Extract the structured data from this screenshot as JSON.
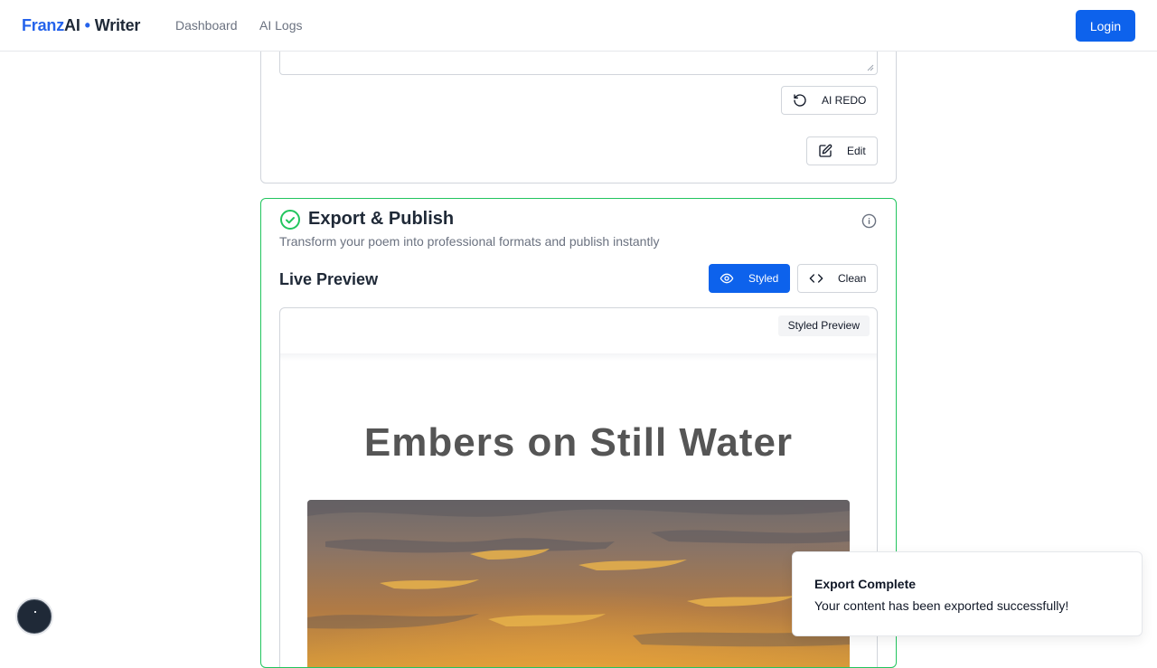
{
  "header": {
    "brand_franz": "Franz",
    "brand_ai": "AI",
    "brand_dot": "•",
    "brand_writer": "Writer",
    "nav": [
      "Dashboard",
      "AI Logs"
    ],
    "login_label": "Login"
  },
  "edit_card": {
    "redo_label": "AI REDO",
    "redo_icon": "rotate-ccw-icon",
    "edit_label": "Edit",
    "edit_icon": "pencil-square-icon"
  },
  "export_card": {
    "title": "Export & Publish",
    "subtitle": "Transform your poem into professional formats and publish instantly",
    "status_icon": "check-circle-icon",
    "info_icon": "info-icon",
    "live_preview_label": "Live Preview",
    "view_modes": [
      {
        "label": "Styled",
        "icon": "eye-icon",
        "active": true
      },
      {
        "label": "Clean",
        "icon": "code-icon",
        "active": false
      }
    ],
    "preview_tag": "Styled Preview",
    "poem_title": "Embers on Still Water"
  },
  "toast": {
    "title": "Export Complete",
    "message": "Your content has been exported successfully!"
  },
  "colors": {
    "primary": "#0d62ec",
    "brand_blue": "#2563eb",
    "success_border": "#22c55e",
    "muted_text": "#6b7280"
  }
}
